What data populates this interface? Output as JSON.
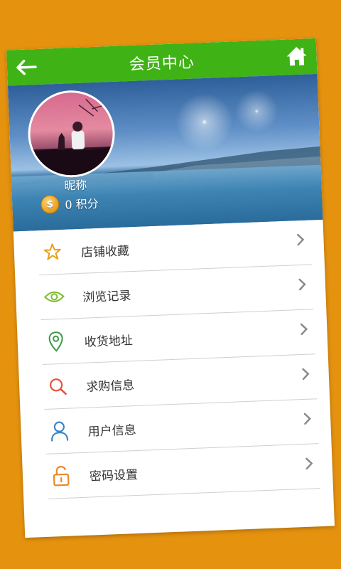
{
  "header": {
    "title": "会员中心",
    "back_icon": "arrow-left-icon",
    "home_icon": "home-icon",
    "bg_color": "#3fb316"
  },
  "profile": {
    "nickname": "昵称",
    "points_text": "0 积分",
    "coin_icon": "dollar-coin-icon"
  },
  "menu": {
    "items": [
      {
        "label": "店铺收藏",
        "icon": "star-icon",
        "icon_color": "#e6a01a"
      },
      {
        "label": "浏览记录",
        "icon": "eye-icon",
        "icon_color": "#7dbb2c"
      },
      {
        "label": "收货地址",
        "icon": "location-pin-icon",
        "icon_color": "#3c9a47"
      },
      {
        "label": "求购信息",
        "icon": "search-icon",
        "icon_color": "#e2533c"
      },
      {
        "label": "用户信息",
        "icon": "user-icon",
        "icon_color": "#3a86c8"
      },
      {
        "label": "密码设置",
        "icon": "unlock-icon",
        "icon_color": "#e8892b"
      }
    ]
  },
  "colors": {
    "page_bg": "#e5920f",
    "chevron": "#8a8a8a"
  }
}
